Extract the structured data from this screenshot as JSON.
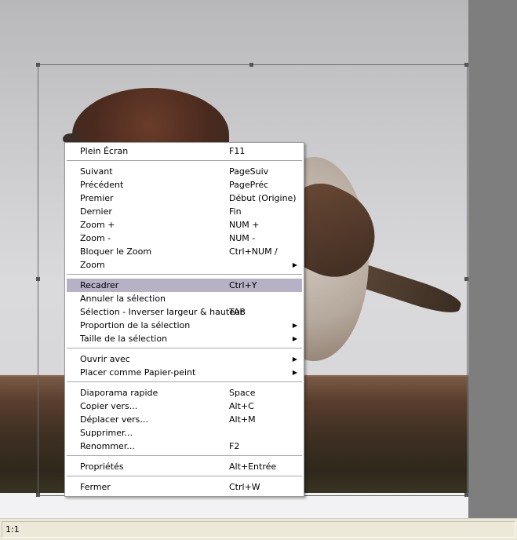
{
  "menu": {
    "items": [
      {
        "label": "Plein Écran",
        "shortcut": "F11",
        "submenu": false
      },
      {
        "label": "Suivant",
        "shortcut": "PageSuiv",
        "submenu": false
      },
      {
        "label": "Précédent",
        "shortcut": "PagePréc",
        "submenu": false
      },
      {
        "label": "Premier",
        "shortcut": "Début (Origine)",
        "submenu": false
      },
      {
        "label": "Dernier",
        "shortcut": "Fin",
        "submenu": false
      },
      {
        "label": "Zoom +",
        "shortcut": "NUM +",
        "submenu": false
      },
      {
        "label": "Zoom -",
        "shortcut": "NUM -",
        "submenu": false
      },
      {
        "label": "Bloquer le Zoom",
        "shortcut": "Ctrl+NUM /",
        "submenu": false
      },
      {
        "label": "Zoom",
        "shortcut": "",
        "submenu": true
      },
      {
        "label": "Recadrer",
        "shortcut": "Ctrl+Y",
        "submenu": false,
        "highlighted": true
      },
      {
        "label": "Annuler la sélection",
        "shortcut": "",
        "submenu": false
      },
      {
        "label": "Sélection - Inverser largeur & hauteur",
        "shortcut": "TAB",
        "submenu": false
      },
      {
        "label": "Proportion de la sélection",
        "shortcut": "",
        "submenu": true
      },
      {
        "label": "Taille de la sélection",
        "shortcut": "",
        "submenu": true
      },
      {
        "label": "Ouvrir avec",
        "shortcut": "",
        "submenu": true
      },
      {
        "label": "Placer comme Papier-peint",
        "shortcut": "",
        "submenu": true
      },
      {
        "label": "Diaporama rapide",
        "shortcut": "Space",
        "submenu": false
      },
      {
        "label": "Copier vers...",
        "shortcut": "Alt+C",
        "submenu": false
      },
      {
        "label": "Déplacer vers...",
        "shortcut": "Alt+M",
        "submenu": false
      },
      {
        "label": "Supprimer...",
        "shortcut": "",
        "submenu": false
      },
      {
        "label": "Renommer...",
        "shortcut": "F2",
        "submenu": false
      },
      {
        "label": "Propriétés",
        "shortcut": "Alt+Entrée",
        "submenu": false
      },
      {
        "label": "Fermer",
        "shortcut": "Ctrl+W",
        "submenu": false
      }
    ],
    "submenu_arrow": "▶",
    "highlight_color": "#b6b1c5"
  },
  "status_bar": {
    "zoom": "1:1"
  },
  "icons": {
    "submenu": "submenu-arrow-icon",
    "handle": "resize-handle-icon"
  }
}
